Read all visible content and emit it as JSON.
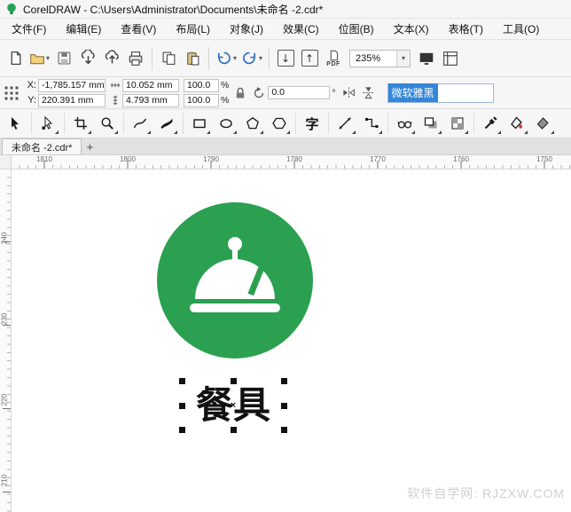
{
  "window": {
    "title": "CorelDRAW - C:\\Users\\Administrator\\Documents\\未命名 -2.cdr*"
  },
  "menu": {
    "items": [
      "文件(F)",
      "编辑(E)",
      "查看(V)",
      "布局(L)",
      "对象(J)",
      "效果(C)",
      "位图(B)",
      "文本(X)",
      "表格(T)",
      "工具(O)"
    ]
  },
  "toolbar": {
    "pdf_label": "PDF",
    "zoom_level": "235%",
    "import_glyph": "↓",
    "export_glyph": "↑",
    "dropdown_glyph": "▾"
  },
  "property_bar": {
    "x_label": "X:",
    "y_label": "Y:",
    "x_value": "-1,785.157 mm",
    "y_value": "220.391 mm",
    "width_value": "10.052 mm",
    "height_value": "4.793 mm",
    "scale_x": "100.0",
    "scale_y": "100.0",
    "percent": "%",
    "rotation_value": "0.0",
    "degree": "°",
    "font_name": "微软雅黑"
  },
  "toolbox": {
    "text_tool_glyph": "字",
    "tools": [
      "pick",
      "shape",
      "crop",
      "zoom",
      "freehand",
      "artistic-media",
      "rectangle",
      "ellipse",
      "polygon",
      "common-shapes",
      "text",
      "parallel-dimension",
      "connector",
      "glasses-effect",
      "drop-shadow",
      "transparency",
      "color-eyedropper",
      "interactive-fill",
      "smart-fill"
    ]
  },
  "document": {
    "tab_title": "未命名 -2.cdr*",
    "new_tab_glyph": "+"
  },
  "rulers": {
    "horizontal": [
      "1810",
      "1800",
      "1790",
      "1780",
      "1770",
      "1760",
      "1750"
    ],
    "vertical": [
      "240",
      "230",
      "220",
      "210"
    ]
  },
  "canvas": {
    "label_text": "餐具",
    "center_mark": "×",
    "watermark": "软件自学网: RJZXW.COM",
    "logo_color": "#2aa050"
  }
}
